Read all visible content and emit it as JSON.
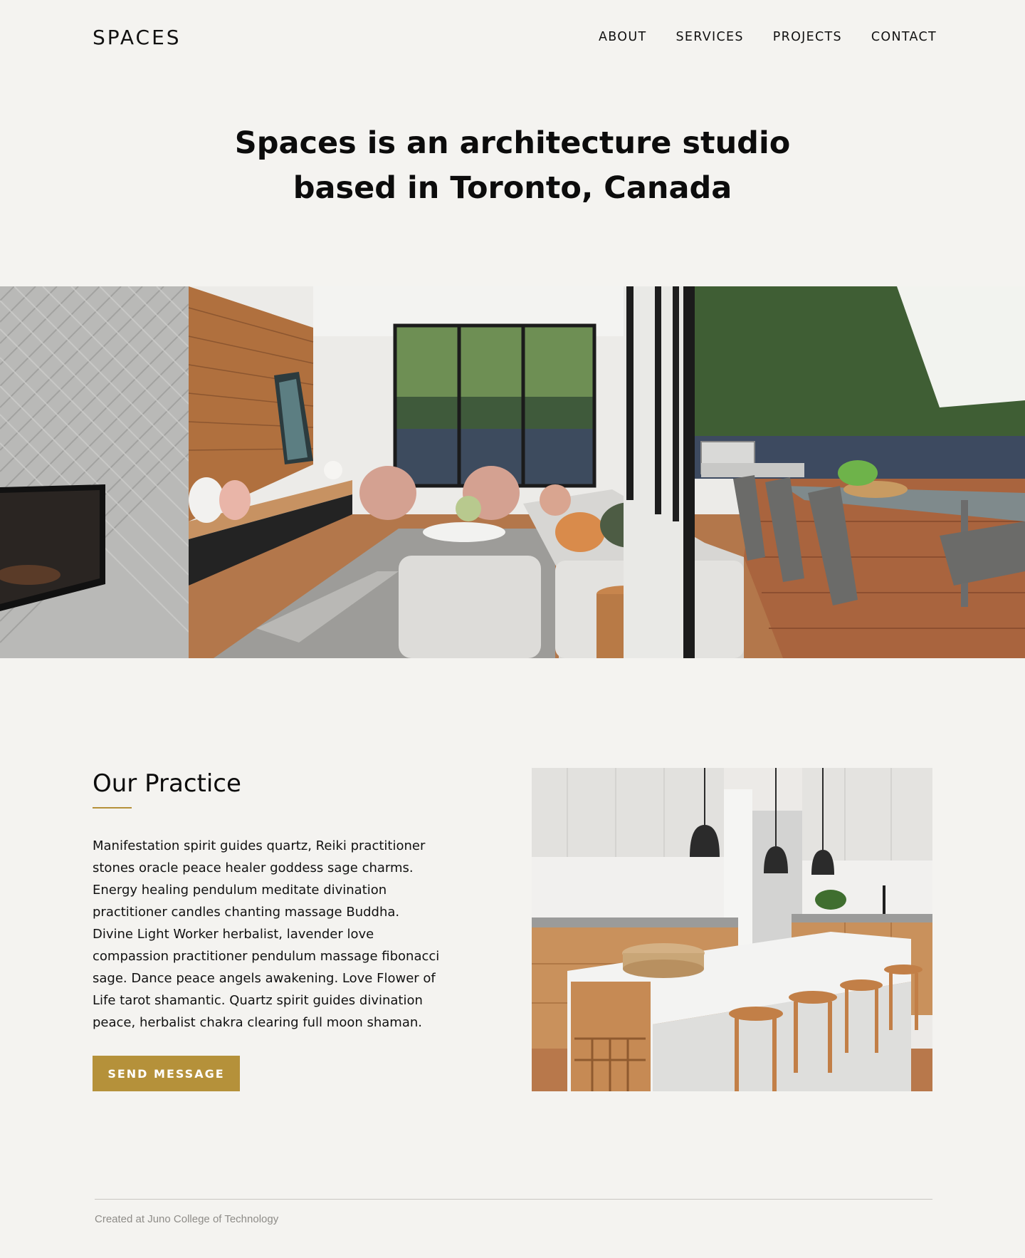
{
  "header": {
    "logo": "SPACES",
    "nav": [
      {
        "label": "ABOUT"
      },
      {
        "label": "SERVICES"
      },
      {
        "label": "PROJECTS"
      },
      {
        "label": "CONTACT"
      }
    ]
  },
  "hero": {
    "title_line1": "Spaces is an architecture studio",
    "title_line2": "based in Toronto, Canada"
  },
  "practice": {
    "heading": "Our Practice",
    "body": "Manifestation spirit guides quartz, Reiki practitioner stones oracle peace healer goddess sage charms. Energy healing pendulum meditate divination practitioner candles chanting massage Buddha. Divine Light Worker herbalist, lavender love compassion practitioner pendulum massage fibonacci sage. Dance peace angels awakening. Love Flower of Life tarot shamantic. Quartz spirit guides divination peace, herbalist chakra clearing full moon shaman.",
    "button_label": "SEND MESSAGE"
  },
  "footer": {
    "text": "Created at Juno College of Technology"
  },
  "colors": {
    "background": "#f4f3f0",
    "accent": "#b5913a"
  }
}
